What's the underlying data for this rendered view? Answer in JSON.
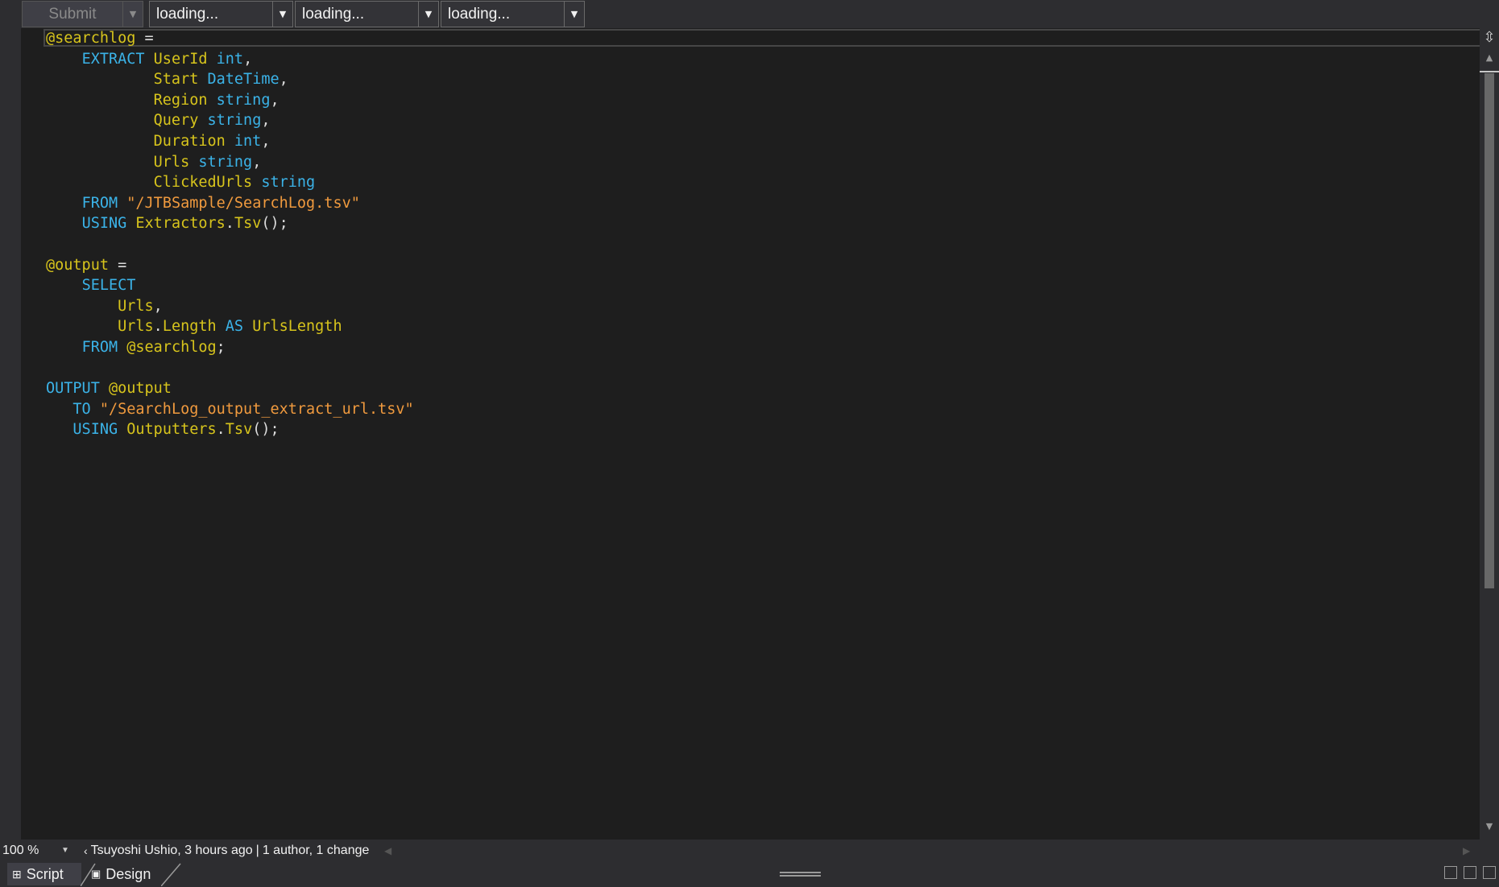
{
  "toolbar": {
    "submit_label": "Submit",
    "combo_1": "loading...",
    "combo_2": "loading...",
    "combo_3": "loading..."
  },
  "editor": {
    "language": "U-SQL",
    "lines": [
      [
        {
          "t": "id",
          "v": "@searchlog"
        },
        {
          "t": "op",
          "v": " ="
        }
      ],
      [
        {
          "t": "op",
          "v": "    "
        },
        {
          "t": "kw",
          "v": "EXTRACT"
        },
        {
          "t": "op",
          "v": " "
        },
        {
          "t": "id",
          "v": "UserId"
        },
        {
          "t": "op",
          "v": " "
        },
        {
          "t": "kw",
          "v": "int"
        },
        {
          "t": "op",
          "v": ","
        }
      ],
      [
        {
          "t": "op",
          "v": "            "
        },
        {
          "t": "id",
          "v": "Start"
        },
        {
          "t": "op",
          "v": " "
        },
        {
          "t": "kw",
          "v": "DateTime"
        },
        {
          "t": "op",
          "v": ","
        }
      ],
      [
        {
          "t": "op",
          "v": "            "
        },
        {
          "t": "id",
          "v": "Region"
        },
        {
          "t": "op",
          "v": " "
        },
        {
          "t": "kw",
          "v": "string"
        },
        {
          "t": "op",
          "v": ","
        }
      ],
      [
        {
          "t": "op",
          "v": "            "
        },
        {
          "t": "id",
          "v": "Query"
        },
        {
          "t": "op",
          "v": " "
        },
        {
          "t": "kw",
          "v": "string"
        },
        {
          "t": "op",
          "v": ","
        }
      ],
      [
        {
          "t": "op",
          "v": "            "
        },
        {
          "t": "id",
          "v": "Duration"
        },
        {
          "t": "op",
          "v": " "
        },
        {
          "t": "kw",
          "v": "int"
        },
        {
          "t": "op",
          "v": ","
        }
      ],
      [
        {
          "t": "op",
          "v": "            "
        },
        {
          "t": "id",
          "v": "Urls"
        },
        {
          "t": "op",
          "v": " "
        },
        {
          "t": "kw",
          "v": "string"
        },
        {
          "t": "op",
          "v": ","
        }
      ],
      [
        {
          "t": "op",
          "v": "            "
        },
        {
          "t": "id",
          "v": "ClickedUrls"
        },
        {
          "t": "op",
          "v": " "
        },
        {
          "t": "kw",
          "v": "string"
        }
      ],
      [
        {
          "t": "op",
          "v": "    "
        },
        {
          "t": "kw",
          "v": "FROM"
        },
        {
          "t": "op",
          "v": " "
        },
        {
          "t": "str",
          "v": "\"/JTBSample/SearchLog.tsv\""
        }
      ],
      [
        {
          "t": "op",
          "v": "    "
        },
        {
          "t": "kw",
          "v": "USING"
        },
        {
          "t": "op",
          "v": " "
        },
        {
          "t": "id",
          "v": "Extractors"
        },
        {
          "t": "op",
          "v": "."
        },
        {
          "t": "id",
          "v": "Tsv"
        },
        {
          "t": "op",
          "v": "();"
        }
      ],
      [],
      [
        {
          "t": "id",
          "v": "@output"
        },
        {
          "t": "op",
          "v": " ="
        }
      ],
      [
        {
          "t": "op",
          "v": "    "
        },
        {
          "t": "kw",
          "v": "SELECT"
        }
      ],
      [
        {
          "t": "op",
          "v": "        "
        },
        {
          "t": "id",
          "v": "Urls"
        },
        {
          "t": "op",
          "v": ","
        }
      ],
      [
        {
          "t": "op",
          "v": "        "
        },
        {
          "t": "id",
          "v": "Urls"
        },
        {
          "t": "op",
          "v": "."
        },
        {
          "t": "id",
          "v": "Length"
        },
        {
          "t": "op",
          "v": " "
        },
        {
          "t": "kw",
          "v": "AS"
        },
        {
          "t": "op",
          "v": " "
        },
        {
          "t": "id",
          "v": "UrlsLength"
        }
      ],
      [
        {
          "t": "op",
          "v": "    "
        },
        {
          "t": "kw",
          "v": "FROM"
        },
        {
          "t": "op",
          "v": " "
        },
        {
          "t": "id",
          "v": "@searchlog"
        },
        {
          "t": "op",
          "v": ";"
        }
      ],
      [],
      [
        {
          "t": "kw",
          "v": "OUTPUT"
        },
        {
          "t": "op",
          "v": " "
        },
        {
          "t": "id",
          "v": "@output"
        }
      ],
      [
        {
          "t": "op",
          "v": "   "
        },
        {
          "t": "kw",
          "v": "TO"
        },
        {
          "t": "op",
          "v": " "
        },
        {
          "t": "str",
          "v": "\"/SearchLog_output_extract_url.tsv\""
        }
      ],
      [
        {
          "t": "op",
          "v": "   "
        },
        {
          "t": "kw",
          "v": "USING"
        },
        {
          "t": "op",
          "v": " "
        },
        {
          "t": "id",
          "v": "Outputters"
        },
        {
          "t": "op",
          "v": "."
        },
        {
          "t": "id",
          "v": "Tsv"
        },
        {
          "t": "op",
          "v": "();"
        }
      ]
    ]
  },
  "status": {
    "zoom": "100 %",
    "author": "Tsuyoshi Ushio, 3 hours ago",
    "changes": "1 author, 1 change"
  },
  "tabs": {
    "script": "Script",
    "design": "Design"
  },
  "colors": {
    "keyword": "#3bb3e8",
    "identifier": "#d7c41c",
    "string": "#f09a3e",
    "background": "#1e1e1e"
  },
  "icons": {
    "split": "split-editor-icon",
    "scroll_up": "chevron-up-icon",
    "scroll_down": "chevron-down-icon",
    "blame": "codelens-blame-icon"
  }
}
